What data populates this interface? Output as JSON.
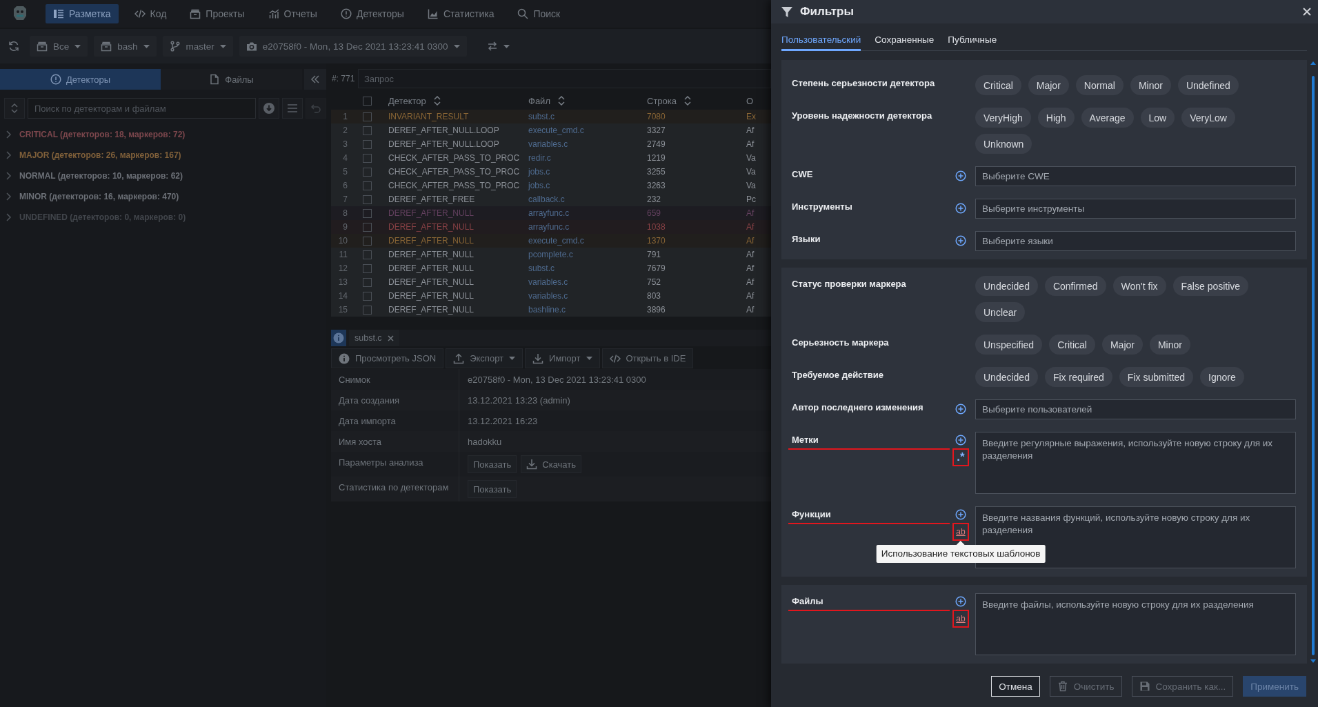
{
  "nav": {
    "items": [
      {
        "label": "Разметка",
        "selected": true
      },
      {
        "label": "Код",
        "selected": false
      },
      {
        "label": "Проекты",
        "selected": false
      },
      {
        "label": "Отчеты",
        "selected": false
      },
      {
        "label": "Детекторы",
        "selected": false
      },
      {
        "label": "Статистика",
        "selected": false
      },
      {
        "label": "Поиск",
        "selected": false
      }
    ]
  },
  "toolbar": {
    "dropdowns": [
      {
        "label": "Все"
      },
      {
        "label": "bash"
      },
      {
        "label": "master"
      },
      {
        "label": "e20758f0 - Mon, 13 Dec 2021 13:23:41 0300"
      }
    ]
  },
  "left_panel": {
    "tabs": [
      {
        "label": "Детекторы",
        "selected": true
      },
      {
        "label": "Файлы",
        "selected": false
      }
    ],
    "search": {
      "placeholder": "Поиск по детекторам и файлам"
    },
    "tree": [
      {
        "label": "CRITICAL (детекторов: 18, маркеров: 72)",
        "color": "#7d474d",
        "expanded": false
      },
      {
        "label": "MAJOR (детекторов: 26, маркеров: 167)",
        "color": "#80603a",
        "expanded": false
      },
      {
        "label": "NORMAL (детекторов: 10, маркеров: 62)",
        "color": "#6c7077",
        "expanded": false
      },
      {
        "label": "MINOR (детекторов: 16, маркеров: 470)",
        "color": "#6c7077",
        "expanded": false
      },
      {
        "label": "UNDEFINED (детекторов: 0, маркеров: 0)",
        "color": "#42464c",
        "expanded": false
      }
    ]
  },
  "query": {
    "count": "#: 771",
    "placeholder": "Запрос"
  },
  "table": {
    "header_checked": false,
    "columns": [
      {
        "label": "Детектор",
        "sortable": true
      },
      {
        "label": "Файл",
        "sortable": true
      },
      {
        "label": "Строка",
        "sortable": true
      },
      {
        "label": "О",
        "sortable": false
      }
    ],
    "rows": [
      {
        "number": "1",
        "checked": false,
        "detector": "INVARIANT_RESULT",
        "file": "subst.c",
        "line": "7080",
        "column_5": "Ex",
        "color": "#8a6635"
      },
      {
        "number": "2",
        "checked": false,
        "detector": "DEREF_AFTER_NULL.LOOP",
        "file": "execute_cmd.c",
        "line": "3327",
        "column_5": "Af",
        "color": "#8c9198"
      },
      {
        "number": "3",
        "checked": false,
        "detector": "DEREF_AFTER_NULL.LOOP",
        "file": "variables.c",
        "line": "2749",
        "column_5": "Af",
        "color": "#8c9198"
      },
      {
        "number": "4",
        "checked": false,
        "detector": "CHECK_AFTER_PASS_TO_PROC",
        "file": "redir.c",
        "line": "1219",
        "column_5": "Va",
        "color": "#8c9198"
      },
      {
        "number": "5",
        "checked": false,
        "detector": "CHECK_AFTER_PASS_TO_PROC",
        "file": "jobs.c",
        "line": "3255",
        "column_5": "Va",
        "color": "#8c9198"
      },
      {
        "number": "6",
        "checked": false,
        "detector": "CHECK_AFTER_PASS_TO_PROC",
        "file": "jobs.c",
        "line": "3263",
        "column_5": "Va",
        "color": "#8c9198"
      },
      {
        "number": "7",
        "checked": false,
        "detector": "DEREF_AFTER_FREE",
        "file": "callback.c",
        "line": "232",
        "column_5": "Pc",
        "color": "#8c9198"
      },
      {
        "number": "8",
        "checked": false,
        "detector": "DEREF_AFTER_NULL",
        "file": "arrayfunc.c",
        "line": "659",
        "column_5": "Af",
        "color": "#63405f"
      },
      {
        "number": "9",
        "checked": false,
        "detector": "DEREF_AFTER_NULL",
        "file": "arrayfunc.c",
        "line": "1038",
        "column_5": "Af",
        "color": "#8a4145"
      },
      {
        "number": "10",
        "checked": false,
        "detector": "DEREF_AFTER_NULL",
        "file": "execute_cmd.c",
        "line": "1370",
        "column_5": "Af",
        "color": "#8a6635"
      },
      {
        "number": "11",
        "checked": false,
        "detector": "DEREF_AFTER_NULL",
        "file": "pcomplete.c",
        "line": "791",
        "column_5": "Af",
        "color": "#8c9198"
      },
      {
        "number": "12",
        "checked": false,
        "detector": "DEREF_AFTER_NULL",
        "file": "subst.c",
        "line": "7679",
        "column_5": "Af",
        "color": "#8c9198"
      },
      {
        "number": "13",
        "checked": false,
        "detector": "DEREF_AFTER_NULL",
        "file": "variables.c",
        "line": "752",
        "column_5": "Af",
        "color": "#8c9198"
      },
      {
        "number": "14",
        "checked": false,
        "detector": "DEREF_AFTER_NULL",
        "file": "variables.c",
        "line": "803",
        "column_5": "Af",
        "color": "#8c9198"
      },
      {
        "number": "15",
        "checked": false,
        "detector": "DEREF_AFTER_NULL",
        "file": "bashline.c",
        "line": "3896",
        "column_5": "Af",
        "color": "#8c9198"
      }
    ]
  },
  "details": {
    "tab": {
      "label": "subst.c"
    },
    "actions": [
      {
        "label": "Просмотреть JSON",
        "kind": "info",
        "dropdown": false
      },
      {
        "label": "Экспорт",
        "kind": "export",
        "dropdown": true
      },
      {
        "label": "Импорт",
        "kind": "import",
        "dropdown": true
      },
      {
        "label": "Открыть в IDE",
        "kind": "code",
        "dropdown": false
      }
    ],
    "properties": [
      {
        "label": "Снимок",
        "value": "e20758f0 - Mon, 13 Dec 2021 13:23:41 0300"
      },
      {
        "label": "Дата создания",
        "value": "13.12.2021 13:23 (admin)"
      },
      {
        "label": "Дата импорта",
        "value": "13.12.2021 16:23"
      },
      {
        "label": "Имя хоста",
        "value": "hadokku"
      },
      {
        "label": "Параметры анализа",
        "buttons": [
          {
            "label": "Показать",
            "kind": "plain"
          },
          {
            "label": "Скачать",
            "kind": "download"
          }
        ]
      },
      {
        "label": "Статистика по детекторам",
        "buttons": [
          {
            "label": "Показать",
            "kind": "plain"
          }
        ]
      }
    ]
  },
  "filters": {
    "title": "Фильтры",
    "tabs": [
      {
        "label": "Пользовательский",
        "selected": true
      },
      {
        "label": "Сохраненные",
        "selected": false
      },
      {
        "label": "Публичные",
        "selected": false
      }
    ],
    "sections": [
      {
        "rows": [
          {
            "kind": "chips",
            "label": "Степень серьезности детектора",
            "chips": [
              {
                "label": "Critical",
                "selected": false
              },
              {
                "label": "Major",
                "selected": false
              },
              {
                "label": "Normal",
                "selected": false
              },
              {
                "label": "Minor",
                "selected": false
              },
              {
                "label": "Undefined",
                "selected": false
              }
            ]
          },
          {
            "kind": "chips",
            "label": "Уровень надежности детектора",
            "chips": [
              {
                "label": "VeryHigh",
                "selected": false
              },
              {
                "label": "High",
                "selected": false
              },
              {
                "label": "Average",
                "selected": false
              },
              {
                "label": "Low",
                "selected": false
              },
              {
                "label": "VeryLow",
                "selected": false
              },
              {
                "label": "Unknown",
                "selected": false
              }
            ]
          },
          {
            "kind": "select",
            "label": "CWE",
            "placeholder": "Выберите CWE"
          },
          {
            "kind": "select",
            "label": "Инструменты",
            "placeholder": "Выберите инструменты"
          },
          {
            "kind": "select",
            "label": "Языки",
            "placeholder": "Выберите языки"
          }
        ]
      },
      {
        "rows": [
          {
            "kind": "chips",
            "label": "Статус проверки маркера",
            "chips": [
              {
                "label": "Undecided",
                "selected": false
              },
              {
                "label": "Confirmed",
                "selected": false
              },
              {
                "label": "Won't fix",
                "selected": false
              },
              {
                "label": "False positive",
                "selected": false
              },
              {
                "label": "Unclear",
                "selected": false
              }
            ]
          },
          {
            "kind": "chips",
            "label": "Серьезность маркера",
            "chips": [
              {
                "label": "Unspecified",
                "selected": false
              },
              {
                "label": "Critical",
                "selected": false
              },
              {
                "label": "Major",
                "selected": false
              },
              {
                "label": "Minor",
                "selected": false
              }
            ]
          },
          {
            "kind": "chips",
            "label": "Требуемое действие",
            "chips": [
              {
                "label": "Undecided",
                "selected": false
              },
              {
                "label": "Fix required",
                "selected": false
              },
              {
                "label": "Fix submitted",
                "selected": false
              },
              {
                "label": "Ignore",
                "selected": false
              }
            ]
          },
          {
            "kind": "select",
            "label": "Автор последнего изменения",
            "placeholder": "Выберите пользователей"
          },
          {
            "kind": "textarea",
            "label": "Метки",
            "placeholder": "Введите регулярные выражения, используйте новую строку для их разделения",
            "toggle": {
              "kind": "regex",
              "label": ".*"
            },
            "highlighted": true
          },
          {
            "kind": "textarea",
            "label": "Функции",
            "placeholder": "Введите названия функций, используйте новую строку для их разделения",
            "toggle": {
              "kind": "text",
              "label": "ab"
            },
            "highlighted": true,
            "tooltip": "Использование текстовых шаблонов"
          }
        ]
      },
      {
        "rows": [
          {
            "kind": "textarea",
            "label": "Файлы",
            "placeholder": "Введите файлы, используйте новую строку для их разделения",
            "toggle": {
              "kind": "text",
              "label": "ab"
            },
            "highlighted": true
          }
        ]
      }
    ],
    "buttons": [
      {
        "label": "Отмена",
        "kind": "cancel",
        "disabled": false
      },
      {
        "label": "Очистить",
        "kind": "clear",
        "disabled": true
      },
      {
        "label": "Сохранить как...",
        "kind": "save",
        "disabled": true
      },
      {
        "label": "Применить",
        "kind": "apply",
        "disabled": true
      }
    ]
  }
}
